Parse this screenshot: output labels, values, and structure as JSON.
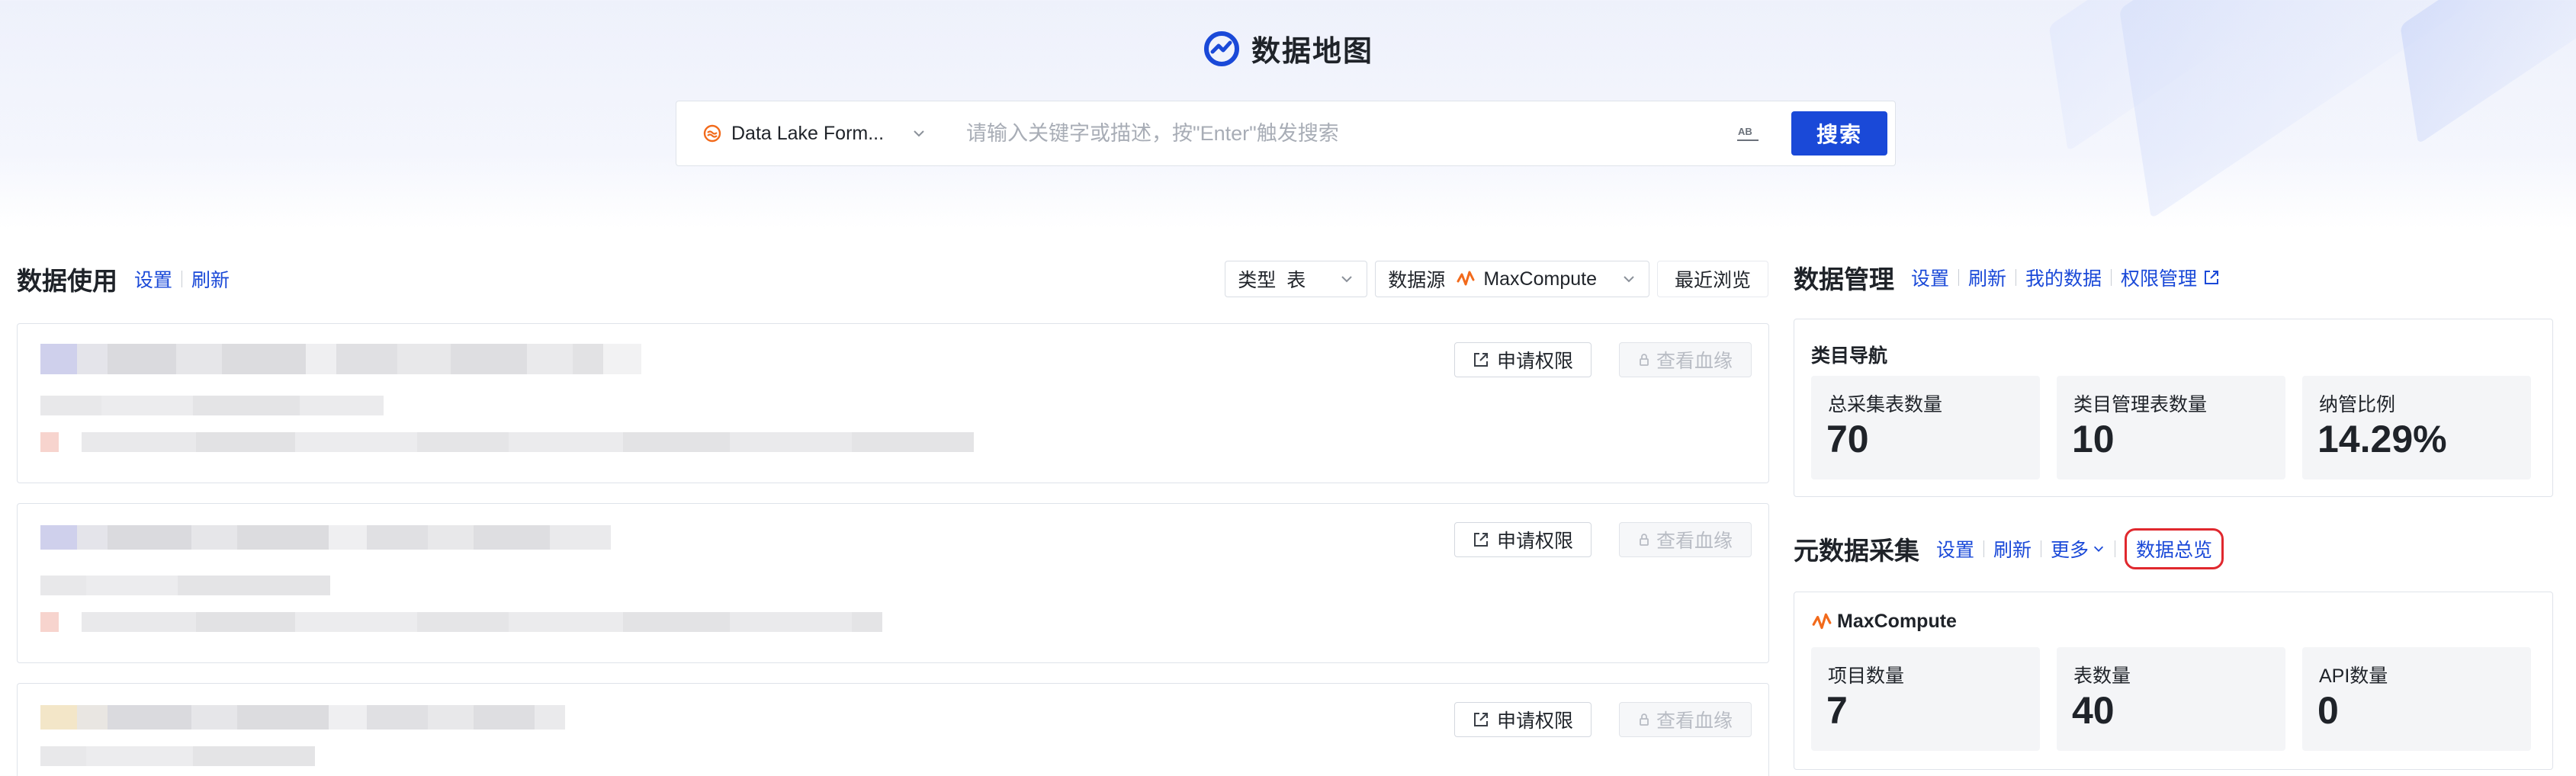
{
  "header": {
    "title": "数据地图"
  },
  "search": {
    "source_label": "Data Lake Form...",
    "placeholder": "请输入关键字或描述，按\"Enter\"触发搜索",
    "button": "搜索"
  },
  "data_usage": {
    "title": "数据使用",
    "links": [
      "设置",
      "刷新"
    ],
    "filter_type": {
      "label": "类型",
      "value": "表"
    },
    "filter_source": {
      "label": "数据源",
      "value": "MaxCompute"
    },
    "recent": "最近浏览",
    "cards": [
      {
        "apply_label": "申请权限",
        "lineage_label": "查看血缘"
      },
      {
        "apply_label": "申请权限",
        "lineage_label": "查看血缘"
      },
      {
        "apply_label": "申请权限",
        "lineage_label": "查看血缘"
      }
    ]
  },
  "data_management": {
    "title": "数据管理",
    "links": [
      "设置",
      "刷新",
      "我的数据",
      "权限管理"
    ],
    "category_nav": "类目导航",
    "stats": [
      {
        "label": "总采集表数量",
        "value": "70"
      },
      {
        "label": "类目管理表数量",
        "value": "10"
      },
      {
        "label": "纳管比例",
        "value": "14.29%"
      }
    ]
  },
  "metadata_collection": {
    "title": "元数据采集",
    "links": [
      "设置",
      "刷新"
    ],
    "more": "更多",
    "overview": "数据总览",
    "source_name": "MaxCompute",
    "stats": [
      {
        "label": "项目数量",
        "value": "7"
      },
      {
        "label": "表数量",
        "value": "40"
      },
      {
        "label": "API数量",
        "value": "0"
      }
    ]
  },
  "colors": {
    "accent": "#1a49d8",
    "highlight": "#e0282e",
    "maxcompute": "#f26a1b"
  }
}
